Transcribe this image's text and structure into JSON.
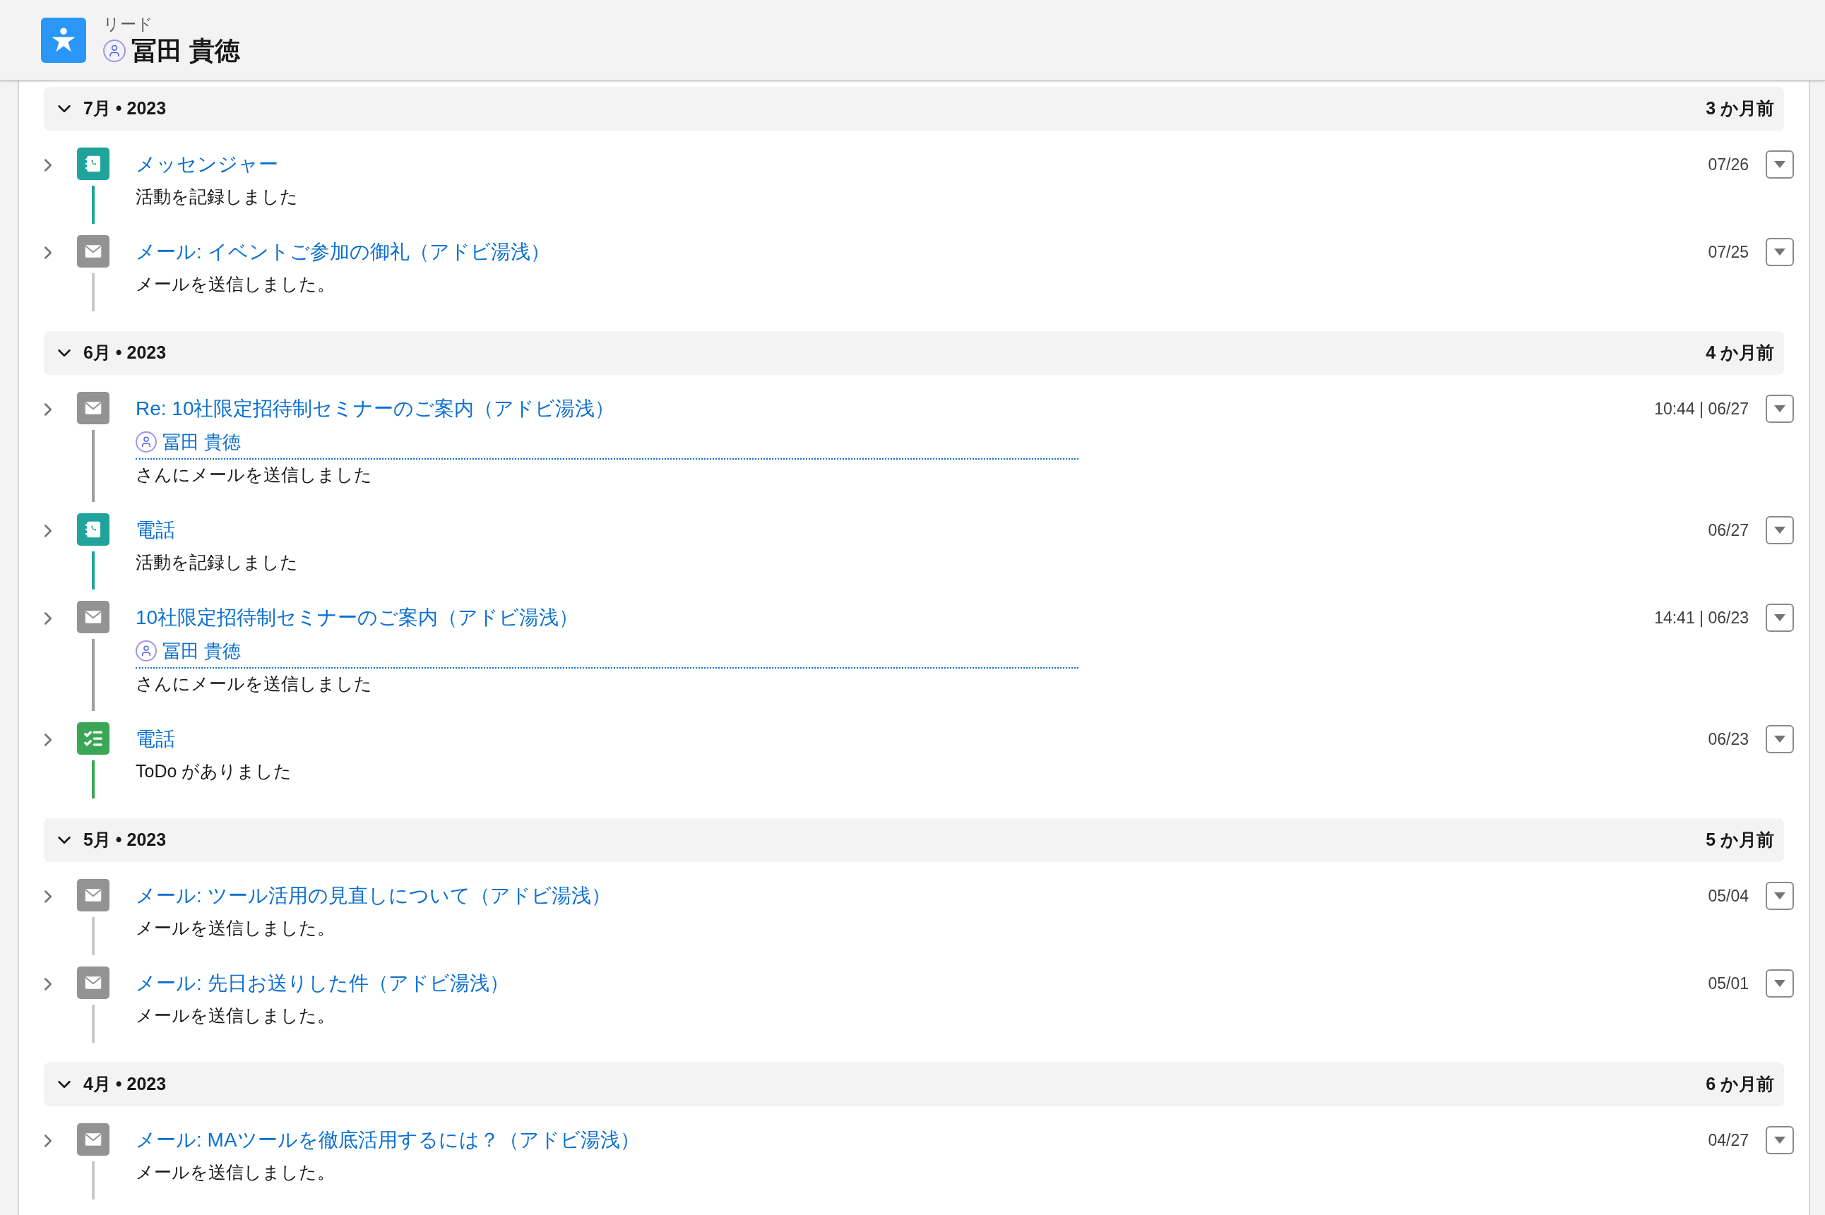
{
  "header": {
    "object_type": "リード",
    "name": "冨田 貴徳"
  },
  "groups": [
    {
      "month": "7月 • 2023",
      "relative": "3 か月前",
      "expanded": true,
      "items": [
        {
          "kind": "call",
          "expanded": false,
          "title": "メッセンジャー",
          "description": "活動を記録しました",
          "date": "07/26"
        },
        {
          "kind": "email",
          "expanded": false,
          "title": "メール: イベントご参加の御礼（アドビ湯浅）",
          "description": "メールを送信しました。",
          "date": "07/25"
        }
      ]
    },
    {
      "month": "6月 • 2023",
      "relative": "4 か月前",
      "expanded": true,
      "items": [
        {
          "kind": "email",
          "expanded": false,
          "title": "Re: 10社限定招待制セミナーのご案内（アドビ湯浅）",
          "recipient": "冨田 貴徳",
          "description": "さんにメールを送信しました",
          "date": "10:44 | 06/27"
        },
        {
          "kind": "call",
          "expanded": false,
          "title": "電話",
          "description": "活動を記録しました",
          "date": "06/27"
        },
        {
          "kind": "email",
          "expanded": false,
          "title": "10社限定招待制セミナーのご案内（アドビ湯浅）",
          "recipient": "冨田 貴徳",
          "description": "さんにメールを送信しました",
          "date": "14:41 | 06/23"
        },
        {
          "kind": "task",
          "expanded": false,
          "title": "電話",
          "description": "ToDo がありました",
          "date": "06/23"
        }
      ]
    },
    {
      "month": "5月 • 2023",
      "relative": "5 か月前",
      "expanded": true,
      "items": [
        {
          "kind": "email",
          "expanded": false,
          "title": "メール: ツール活用の見直しについて（アドビ湯浅）",
          "description": "メールを送信しました。",
          "date": "05/04"
        },
        {
          "kind": "email",
          "expanded": false,
          "title": "メール: 先日お送りした件（アドビ湯浅）",
          "description": "メールを送信しました。",
          "date": "05/01"
        }
      ]
    },
    {
      "month": "4月 • 2023",
      "relative": "6 か月前",
      "expanded": true,
      "items": [
        {
          "kind": "email",
          "expanded": false,
          "title": "メール: MAツールを徹底活用するには？（アドビ湯浅）",
          "description": "メールを送信しました。",
          "date": "04/27"
        }
      ]
    }
  ]
}
